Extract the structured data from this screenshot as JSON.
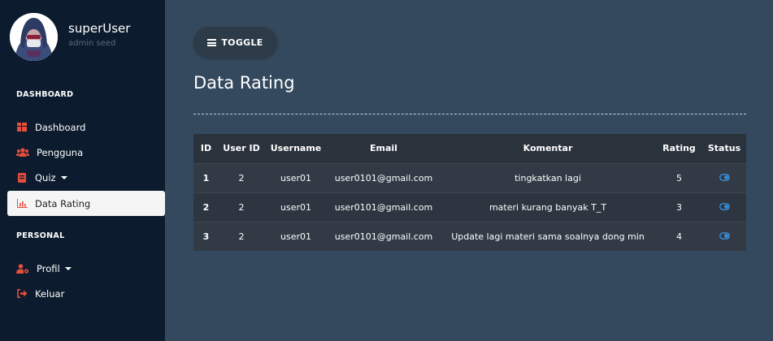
{
  "sidebar": {
    "profile": {
      "name": "superUser",
      "role": "admin seed"
    },
    "sections": {
      "dashboard": "DASHBOARD",
      "personal": "PERSONAL"
    },
    "items": [
      {
        "label": "Dashboard",
        "icon": "dashboard-icon"
      },
      {
        "label": "Pengguna",
        "icon": "users-icon"
      },
      {
        "label": "Quiz",
        "icon": "quiz-icon"
      },
      {
        "label": "Data Rating",
        "icon": "chart-icon"
      },
      {
        "label": "Profil",
        "icon": "user-cog-icon"
      },
      {
        "label": "Keluar",
        "icon": "sign-out-icon"
      }
    ]
  },
  "toolbar": {
    "toggle_label": "TOGGLE"
  },
  "page": {
    "title": "Data Rating"
  },
  "table": {
    "headers": [
      "ID",
      "User ID",
      "Username",
      "Email",
      "Komentar",
      "Rating",
      "Status"
    ],
    "rows": [
      {
        "id": "1",
        "user_id": "2",
        "username": "user01",
        "email": "user0101@gmail.com",
        "komentar": "tingkatkan lagi",
        "rating": "5"
      },
      {
        "id": "2",
        "user_id": "2",
        "username": "user01",
        "email": "user0101@gmail.com",
        "komentar": "materi kurang banyak T_T",
        "rating": "3"
      },
      {
        "id": "3",
        "user_id": "2",
        "username": "user01",
        "email": "user0101@gmail.com",
        "komentar": "Update lagi materi sama soalnya dong min",
        "rating": "4"
      }
    ]
  },
  "colors": {
    "accent": "#e74c3c",
    "status": "#3b8fd9",
    "sidebar": "#0c1c2e",
    "main": "#34495e"
  }
}
